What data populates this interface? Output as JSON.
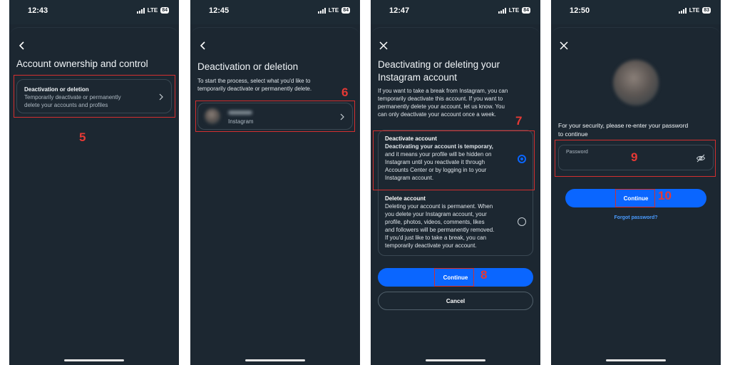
{
  "colors": {
    "accent": "#0a66ff",
    "annotation": "#e53935",
    "background": "#1c2731"
  },
  "screens": [
    {
      "time": "12:43",
      "network": "LTE",
      "battery": "84",
      "title": "Account ownership and control",
      "item": {
        "title": "Deactivation or deletion",
        "subtitle_line1": "Temporarily deactivate or permanently",
        "subtitle_line2": "delete your accounts and profiles"
      },
      "step": "5"
    },
    {
      "time": "12:45",
      "network": "LTE",
      "battery": "84",
      "title": "Deactivation or deletion",
      "desc_line1": "To start the process, select what you'd like to",
      "desc_line2": "temporarily deactivate or permanently delete.",
      "account": {
        "platform": "Instagram"
      },
      "step": "6"
    },
    {
      "time": "12:47",
      "network": "LTE",
      "battery": "84",
      "title_line1": "Deactivating or deleting your",
      "title_line2": "Instagram account",
      "intro": [
        "If you want to take a break from Instagram, you can",
        "temporarily deactivate this account. If you want to",
        "permanently delete your account, let us know.  You",
        "can only deactivate your account once a week."
      ],
      "option_deactivate": {
        "title": "Deactivate account",
        "lines": [
          "Deactivating your account is temporary,",
          "and it means your profile will be hidden on",
          "Instagram until you reactivate it through",
          "Accounts Center or by logging in to your",
          "Instagram account."
        ],
        "selected": true
      },
      "option_delete": {
        "title": "Delete account",
        "lines": [
          "Deleting your account is permanent. When",
          "you delete your Instagram account, your",
          "profile, photos, videos, comments, likes",
          "and followers will be permanently removed.",
          "If you'd just like to take a break, you can",
          "temporarily deactivate your account."
        ],
        "selected": false
      },
      "continue_label": "Continue",
      "cancel_label": "Cancel",
      "step_option": "7",
      "step_continue": "8"
    },
    {
      "time": "12:50",
      "network": "LTE",
      "battery": "83",
      "prompt_line1": "For your security, please re-enter your password",
      "prompt_line2": "to continue",
      "password_placeholder": "Password",
      "continue_label": "Continue",
      "forgot_label": "Forgot password?",
      "step_password": "9",
      "step_continue": "10"
    }
  ]
}
